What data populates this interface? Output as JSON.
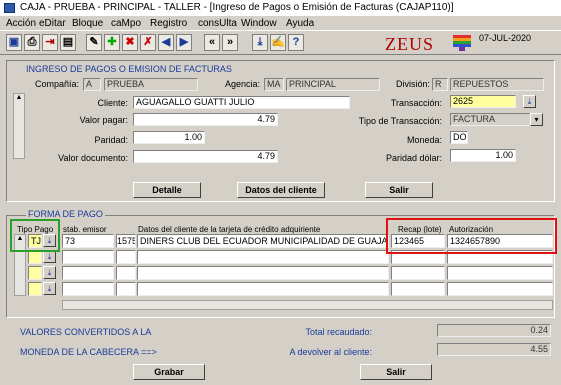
{
  "window": {
    "title": "CAJA - PRUEBA - PRINCIPAL - TALLER - [Ingreso de Pagos o Emisión de Facturas (CAJAP110)]"
  },
  "menu": [
    "Acción",
    "eDitar",
    "Bloque",
    "caMpo",
    "Registro",
    "consUlta",
    "Window",
    "Ayuda"
  ],
  "toolbar": {
    "brand": "ZEUS",
    "date": "07-JUL-2020"
  },
  "form": {
    "section_title": "INGRESO DE PAGOS O EMISION DE FACTURAS",
    "compania_label": "Compañía:",
    "compania_code": "A",
    "compania_name": "PRUEBA",
    "agencia_label": "Agencia:",
    "agencia_code": "MA",
    "agencia_name": "PRINCIPAL",
    "division_label": "División:",
    "division_code": "R",
    "division_name": "REPUESTOS",
    "cliente_label": "Cliente:",
    "cliente_value": "AGUAGALLO GUATTI JULIO",
    "transaccion_label": "Transacción:",
    "transaccion_value": "2625",
    "valor_pagar_label": "Valor pagar:",
    "valor_pagar_value": "4.79",
    "tipo_transaccion_label": "Tipo de Transacción:",
    "tipo_transaccion_value": "FACTURA",
    "paridad_label": "Paridad:",
    "paridad_value": "1.00",
    "moneda_label": "Moneda:",
    "moneda_value": "DO",
    "valor_documento_label": "Valor documento:",
    "valor_documento_value": "4.79",
    "paridad_dolar_label": "Paridad dólar:",
    "paridad_dolar_value": "1.00"
  },
  "buttons": {
    "detalle": "Detalle",
    "datos_cliente": "Datos del cliente",
    "salir_top": "Salir",
    "grabar": "Grabar",
    "salir_bottom": "Salir"
  },
  "payment": {
    "section_title": "FORMA DE PAGO",
    "headers": {
      "tipo_pago": "Tipo Pago",
      "emisor": "stab. emisor",
      "datos": "Datos del cliente de la tarjeta de crédito adquiriente",
      "recap": "Recap (lote)",
      "autorizacion": "Autorización"
    },
    "row": {
      "tipo": "TJ",
      "emisor": "73",
      "codigo": "1575",
      "datos": "DINERS CLUB DEL ECUADOR MUNICIPALIDAD DE GUAJA",
      "recap": "123465",
      "autorizacion": "1324657890"
    }
  },
  "footer": {
    "valores_label": "VALORES CONVERTIDOS A LA",
    "moneda_label": "MONEDA DE LA CABECERA ==>",
    "total_label": "Total recaudado:",
    "total_value": "0.24",
    "devolver_label": "A devolver al cliente:",
    "devolver_value": "4.55"
  },
  "colors": {
    "highlight_green": "#2aa02a",
    "highlight_red": "#e01010",
    "brand_red": "#b00000"
  }
}
